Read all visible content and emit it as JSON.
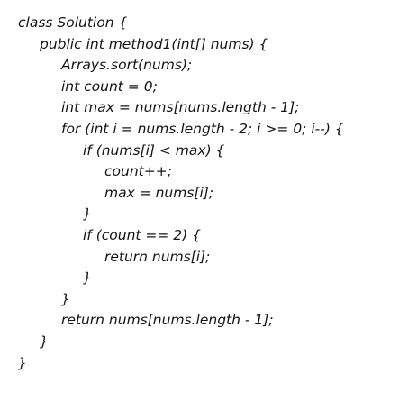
{
  "code": {
    "lines": [
      {
        "indent": 0,
        "text": "class Solution {"
      },
      {
        "indent": 1,
        "text": "public int method1(int[] nums) {"
      },
      {
        "indent": 2,
        "text": "Arrays.sort(nums);"
      },
      {
        "indent": 2,
        "text": "int count = 0;"
      },
      {
        "indent": 2,
        "text": "int max = nums[nums.length - 1];"
      },
      {
        "indent": 2,
        "text": "for (int i = nums.length - 2; i >= 0; i--) {"
      },
      {
        "indent": 3,
        "text": "if (nums[i] < max) {"
      },
      {
        "indent": 4,
        "text": "count++;"
      },
      {
        "indent": 4,
        "text": "max = nums[i];"
      },
      {
        "indent": 3,
        "text": "}"
      },
      {
        "indent": 3,
        "text": "if (count == 2) {"
      },
      {
        "indent": 4,
        "text": "return nums[i];"
      },
      {
        "indent": 3,
        "text": "}"
      },
      {
        "indent": 2,
        "text": "}"
      },
      {
        "indent": 2,
        "text": "return nums[nums.length - 1];"
      },
      {
        "indent": 1,
        "text": "}"
      },
      {
        "indent": 0,
        "text": "}"
      }
    ]
  }
}
